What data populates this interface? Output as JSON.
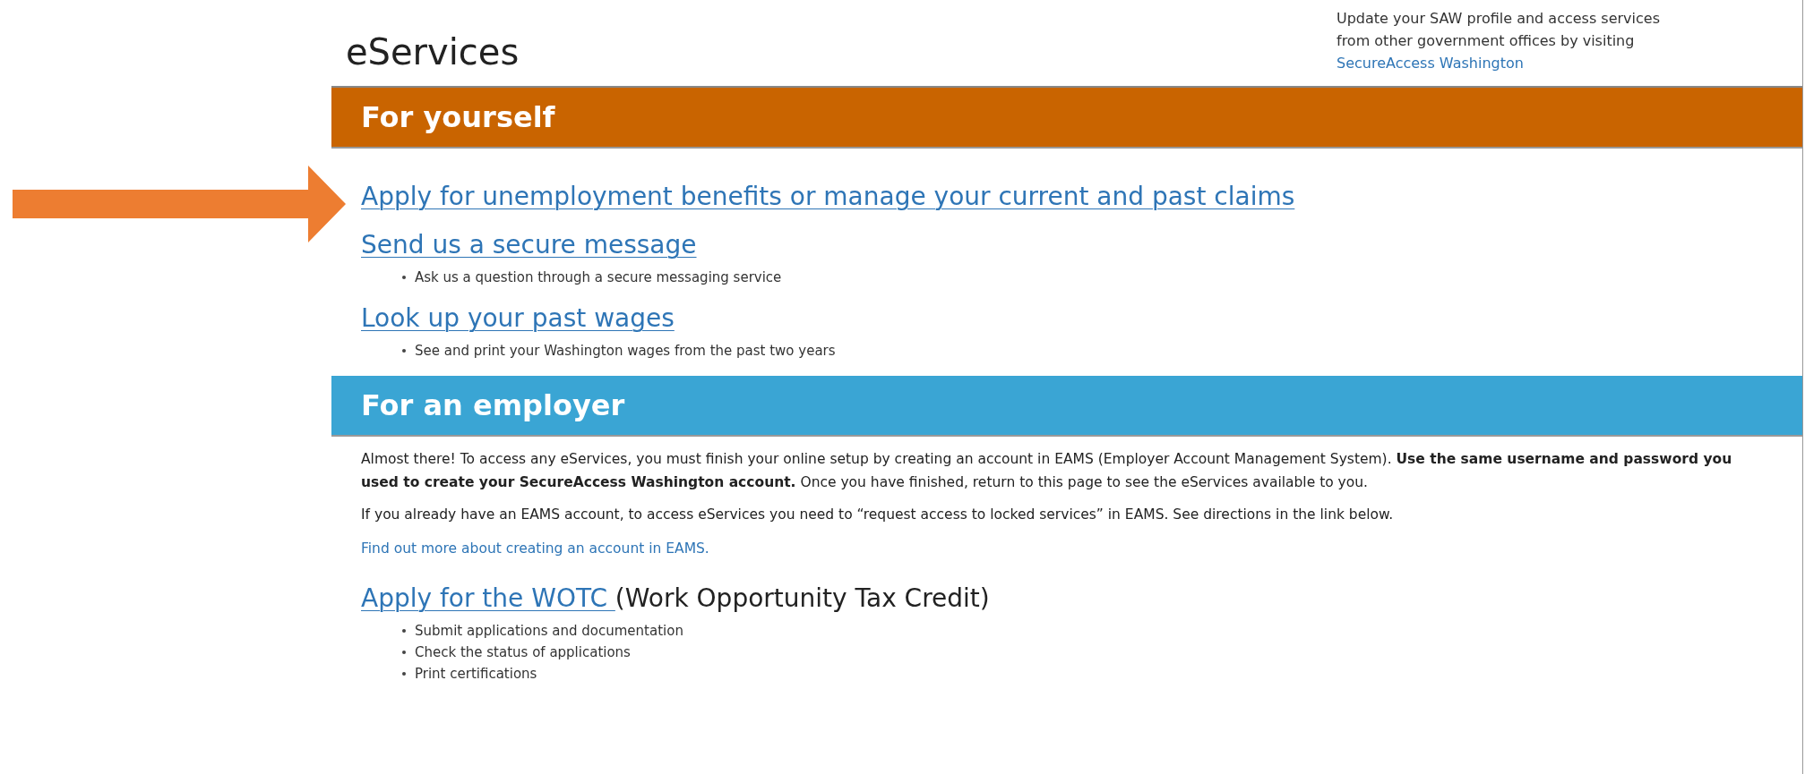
{
  "header": {
    "title": "eServices",
    "note_lines": [
      "Update your SAW profile and access services",
      "from other government offices by visiting"
    ],
    "note_link": "SecureAccess Washington"
  },
  "sections": [
    {
      "heading": "For yourself",
      "color": "#c96400",
      "items": [
        {
          "link": "Apply for unemployment benefits or manage your current and past claims"
        },
        {
          "link": "Send us a secure message",
          "bullets": [
            "Ask us a question through a secure messaging service"
          ]
        },
        {
          "link": "Look up your past wages",
          "bullets": [
            "See and print your Washington wages from the past two years"
          ]
        }
      ]
    },
    {
      "heading": "For an employer",
      "color": "#3aa5d4",
      "paragraphs": [
        "Almost there! To access any eServices, you must finish your online setup by creating an account in EAMS (Employer Account Management System). **Use the same username and password you used to create your SecureAccess Washington account.** Once you have finished, return to this page to see the eServices available to you.",
        "If you already have an EAMS account, to access eServices you need to “request access to locked services” in EAMS. See directions in the link below."
      ],
      "info_link": "Find out more about creating an account in EAMS.",
      "items": [
        {
          "link": "Apply for the WOTC ",
          "suffix": "(Work Opportunity Tax Credit)",
          "bullets": [
            "Submit applications and documentation",
            "Check the status of applications",
            "Print certifications"
          ]
        }
      ]
    }
  ]
}
